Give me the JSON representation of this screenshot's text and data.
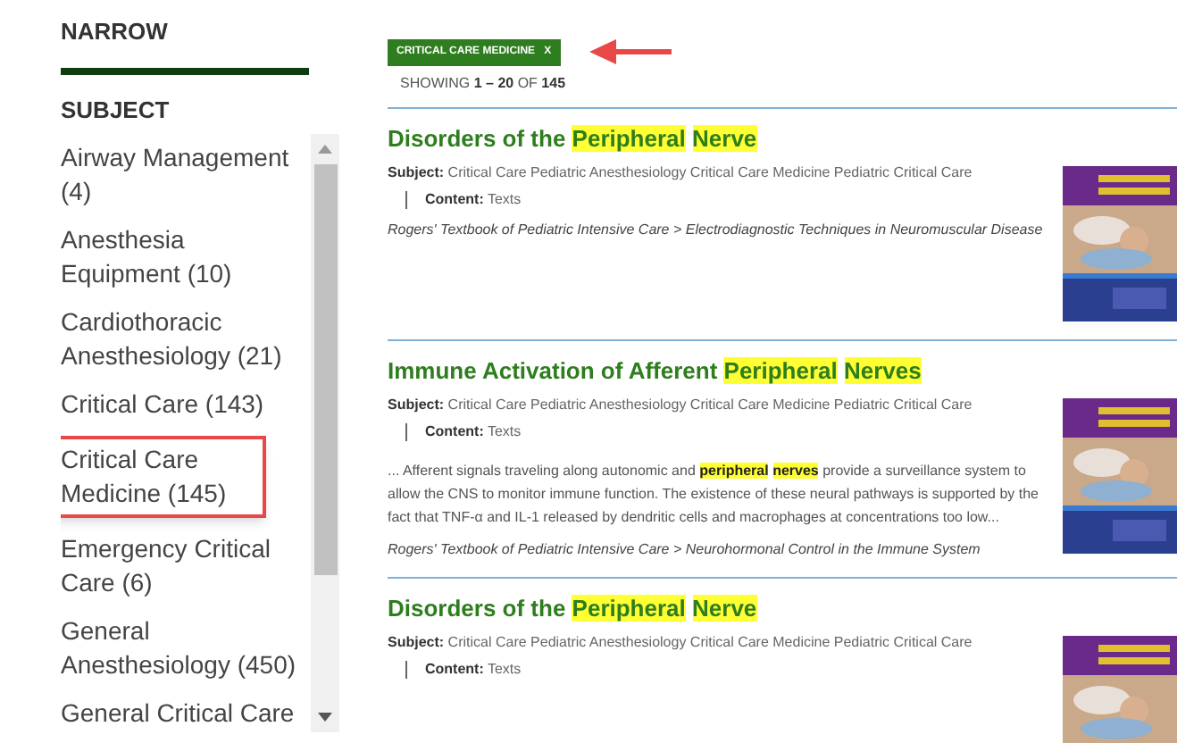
{
  "sidebar": {
    "heading": "NARROW",
    "section": "SUBJECT",
    "items": [
      {
        "label": "Airway Management (4)",
        "marked": false
      },
      {
        "label": "Anesthesia Equipment (10)",
        "marked": false
      },
      {
        "label": "Cardiothoracic Anesthesiology (21)",
        "marked": false
      },
      {
        "label": "Critical Care (143)",
        "marked": false
      },
      {
        "label": "Critical Care Medicine (145)",
        "marked": true
      },
      {
        "label": "Emergency Critical Care (6)",
        "marked": false
      },
      {
        "label": "General Anesthesiology (450)",
        "marked": false
      },
      {
        "label": "General Critical Care",
        "marked": false
      }
    ]
  },
  "filter_tag": {
    "label": "CRITICAL CARE MEDICINE",
    "remove": "X"
  },
  "showing": {
    "prefix": "SHOWING",
    "range": "1 – 20",
    "of": "OF",
    "total": "145"
  },
  "results": [
    {
      "title": [
        {
          "text": "Disorders of the ",
          "highlight": false
        },
        {
          "text": "Peripheral ",
          "highlight": true
        },
        {
          "text": "Nerve",
          "highlight": true
        }
      ],
      "subject_label": "Subject:",
      "subject": "Critical Care Pediatric Anesthesiology Critical Care Medicine Pediatric Critical Care",
      "content_label": "Content:",
      "content": "Texts",
      "path": "Rogers' Textbook of Pediatric Intensive Care > Electrodiagnostic Techniques in Neuromuscular Disease",
      "cover": {
        "kind": "picture"
      }
    },
    {
      "title": [
        {
          "text": "Immune Activation of Afferent ",
          "highlight": false
        },
        {
          "text": "Peripheral ",
          "highlight": true
        },
        {
          "text": "Nerves",
          "highlight": true
        }
      ],
      "subject_label": "Subject:",
      "subject": "Critical Care Pediatric Anesthesiology Critical Care Medicine Pediatric Critical Care",
      "content_label": "Content:",
      "content": "Texts",
      "snippet": [
        {
          "text": "... Afferent signals traveling along autonomic and ",
          "highlight": false
        },
        {
          "text": "peripheral ",
          "highlight": true
        },
        {
          "text": "nerves",
          "highlight": true
        },
        {
          "text": " provide a surveillance system to allow the CNS to monitor immune function. The existence of these neural pathways is supported by the fact that TNF-α and IL-1 released by dendritic cells and macrophages at concentrations too low...",
          "highlight": false
        }
      ],
      "path": "Rogers' Textbook of Pediatric Intensive Care > Neurohormonal Control in the Immune System",
      "cover": {
        "kind": "picture"
      }
    },
    {
      "title": [
        {
          "text": "Disorders of the ",
          "highlight": false
        },
        {
          "text": "Peripheral ",
          "highlight": true
        },
        {
          "text": "Nerve",
          "highlight": true
        }
      ],
      "subject_label": "Subject:",
      "subject": "Critical Care Pediatric Anesthesiology Critical Care Medicine Pediatric Critical Care",
      "content_label": "Content:",
      "content": "Texts",
      "cover": {
        "kind": "picture"
      }
    }
  ]
}
